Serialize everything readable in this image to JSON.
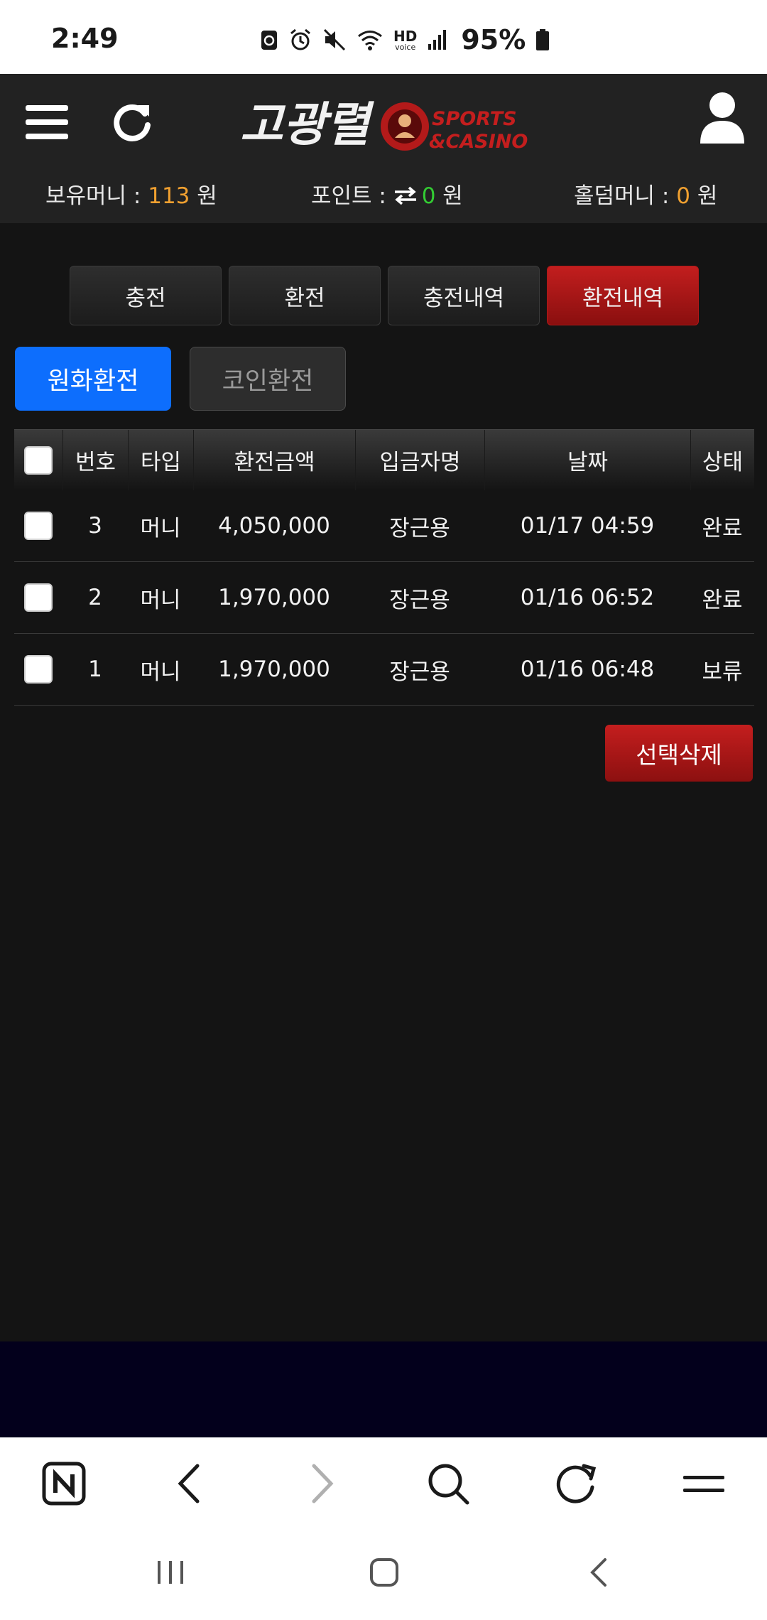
{
  "status_bar": {
    "time": "2:49",
    "hd_label": "HD",
    "voice_label": "voice",
    "battery_percent": "95%",
    "icons": [
      "recycle-icon",
      "alarm-icon",
      "mute-icon",
      "wifi-icon",
      "signal-icon",
      "battery-icon"
    ]
  },
  "header": {
    "logo_text": "고광렬",
    "logo_sub1": "SPORTS",
    "logo_sub2": "&CASINO",
    "icons": [
      "menu-icon",
      "refresh-icon",
      "user-icon"
    ]
  },
  "balances": {
    "hold_label": "보유머니 : ",
    "hold_value": "113",
    "hold_unit": " 원",
    "point_label": "포인트 : ",
    "point_value": "0",
    "point_unit": " 원",
    "holdem_label": "홀덤머니 : ",
    "holdem_value": "0",
    "holdem_unit": " 원"
  },
  "tabs": [
    "충전",
    "환전",
    "충전내역",
    "환전내역"
  ],
  "active_tab": "환전내역",
  "subtabs": {
    "krw": "원화환전",
    "coin": "코인환전"
  },
  "table": {
    "headers": [
      "번호",
      "타입",
      "환전금액",
      "입금자명",
      "날짜",
      "상태"
    ],
    "rows": [
      {
        "num": "3",
        "type": "머니",
        "amount": "4,050,000",
        "depositor": "장근용",
        "date": "01/17 04:59",
        "status": "완료"
      },
      {
        "num": "2",
        "type": "머니",
        "amount": "1,970,000",
        "depositor": "장근용",
        "date": "01/16 06:52",
        "status": "완료"
      },
      {
        "num": "1",
        "type": "머니",
        "amount": "1,970,000",
        "depositor": "장근용",
        "date": "01/16 06:48",
        "status": "보류"
      }
    ]
  },
  "delete_button": "선택삭제",
  "colors": {
    "background": "#141414",
    "header": "#222222",
    "accent_red": "#b01818",
    "accent_blue": "#0d6efd",
    "orange_value": "#f0a030",
    "green_value": "#33cc33",
    "footer_band": "#03001c"
  },
  "browser_toolbar": [
    "naver-home-icon",
    "back-icon",
    "forward-icon",
    "search-icon",
    "reload-icon",
    "menu-icon"
  ],
  "system_nav": [
    "recent-apps-icon",
    "home-icon",
    "back-icon"
  ]
}
